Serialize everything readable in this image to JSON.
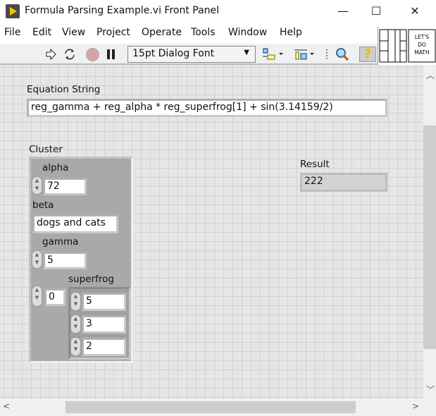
{
  "window": {
    "title": "Formula Parsing Example.vi Front Panel",
    "minimize": "—",
    "maximize": "☐",
    "close": "✕"
  },
  "menu": [
    "File",
    "Edit",
    "View",
    "Project",
    "Operate",
    "Tools",
    "Window",
    "Help"
  ],
  "toolbar": {
    "font": "15pt Dialog Font",
    "help": "?"
  },
  "vi_icon": {
    "text": "LET'S DO MATH"
  },
  "equation": {
    "label": "Equation String",
    "value": "reg_gamma + reg_alpha * reg_superfrog[1] + sin(3.14159/2)"
  },
  "cluster": {
    "label": "Cluster",
    "alpha": {
      "label": "alpha",
      "value": "72"
    },
    "beta": {
      "label": "beta",
      "value": "dogs and cats"
    },
    "gamma": {
      "label": "gamma",
      "value": "5"
    },
    "superfrog": {
      "label": "superfrog",
      "index": "0",
      "values": [
        "5",
        "3",
        "2"
      ]
    }
  },
  "result": {
    "label": "Result",
    "value": "222"
  }
}
